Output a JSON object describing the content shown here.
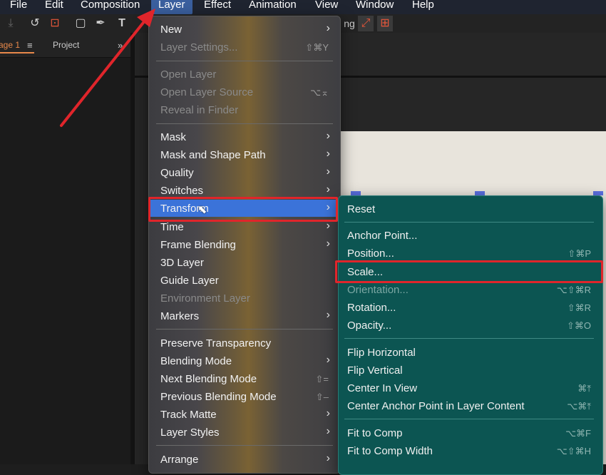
{
  "menubar": {
    "items": [
      {
        "label": "File"
      },
      {
        "label": "Edit"
      },
      {
        "label": "Composition"
      },
      {
        "label": "Layer"
      },
      {
        "label": "Effect"
      },
      {
        "label": "Animation"
      },
      {
        "label": "View"
      },
      {
        "label": "Window"
      },
      {
        "label": "Help"
      }
    ]
  },
  "toolbar": {
    "snap_label_fragment": "ng"
  },
  "left_panel": {
    "tabs": [
      {
        "label": "age 1"
      },
      {
        "label": "Project"
      }
    ],
    "tab_menu_icon": "hamburger-icon",
    "expand_icon": "double-chevron-right-icon"
  },
  "layer_menu": {
    "items": [
      {
        "label": "New",
        "submenu": true
      },
      {
        "label": "Layer Settings...",
        "shortcut": "⇧⌘Y",
        "disabled": true
      },
      {
        "label": "Open Layer",
        "disabled": true
      },
      {
        "label": "Open Layer Source",
        "shortcut": "⌥⌅",
        "disabled": true
      },
      {
        "label": "Reveal in Finder",
        "disabled": true
      },
      {
        "label": "Mask",
        "submenu": true
      },
      {
        "label": "Mask and Shape Path",
        "submenu": true
      },
      {
        "label": "Quality",
        "submenu": true
      },
      {
        "label": "Switches",
        "submenu": true
      },
      {
        "label": "Transform",
        "submenu": true,
        "highlighted": true
      },
      {
        "label": "Time",
        "submenu": true
      },
      {
        "label": "Frame Blending",
        "submenu": true
      },
      {
        "label": "3D Layer"
      },
      {
        "label": "Guide Layer"
      },
      {
        "label": "Environment Layer",
        "disabled": true
      },
      {
        "label": "Markers",
        "submenu": true
      },
      {
        "label": "Preserve Transparency"
      },
      {
        "label": "Blending Mode",
        "submenu": true
      },
      {
        "label": "Next Blending Mode",
        "shortcut": "⇧="
      },
      {
        "label": "Previous Blending Mode",
        "shortcut": "⇧–"
      },
      {
        "label": "Track Matte",
        "submenu": true
      },
      {
        "label": "Layer Styles",
        "submenu": true
      },
      {
        "label": "Arrange",
        "submenu": true
      }
    ]
  },
  "transform_submenu": {
    "items": [
      {
        "label": "Reset"
      },
      {
        "label": "Anchor Point..."
      },
      {
        "label": "Position...",
        "shortcut": "⇧⌘P"
      },
      {
        "label": "Scale..."
      },
      {
        "label": "Orientation...",
        "shortcut": "⌥⇧⌘R",
        "disabled": true
      },
      {
        "label": "Rotation...",
        "shortcut": "⇧⌘R"
      },
      {
        "label": "Opacity...",
        "shortcut": "⇧⌘O"
      },
      {
        "label": "Flip Horizontal"
      },
      {
        "label": "Flip Vertical"
      },
      {
        "label": "Center In View",
        "shortcut": "⌘⤒"
      },
      {
        "label": "Center Anchor Point in Layer Content",
        "shortcut": "⌥⌘⤒"
      },
      {
        "label": "Fit to Comp",
        "shortcut": "⌥⌘F"
      },
      {
        "label": "Fit to Comp Width",
        "shortcut": "⌥⇧⌘H"
      }
    ]
  },
  "annotation": {
    "color": "#e0252b"
  },
  "colors": {
    "highlight": "#3b73d9",
    "submenu_bg": "#0c5552"
  }
}
